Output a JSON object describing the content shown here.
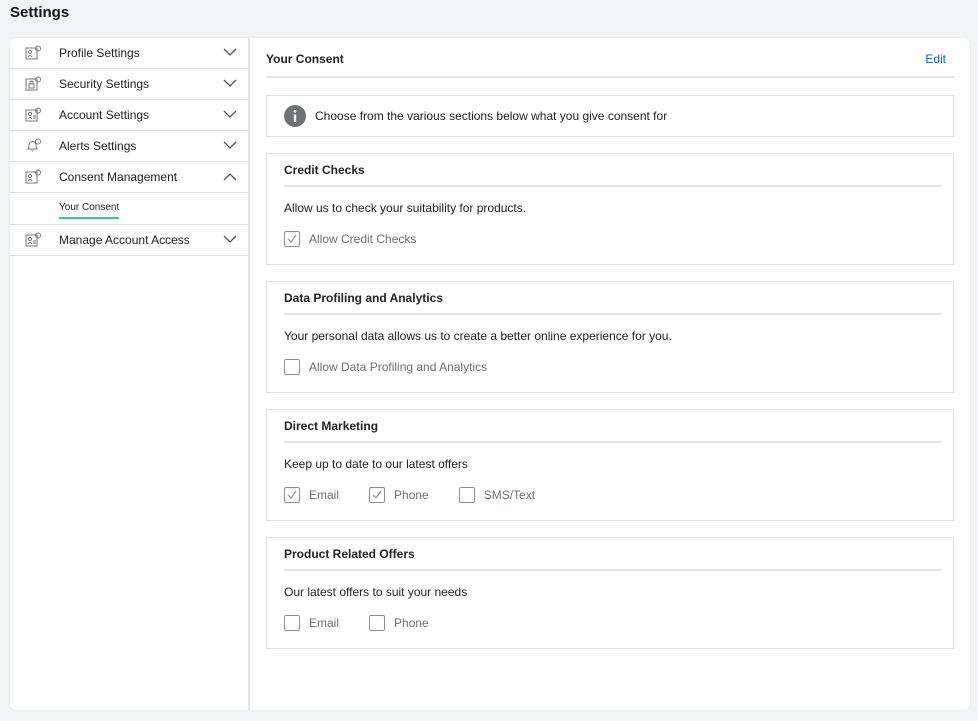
{
  "page": {
    "title": "Settings"
  },
  "sidebar": {
    "items": [
      {
        "label": "Profile Settings",
        "expanded": false
      },
      {
        "label": "Security Settings",
        "expanded": false
      },
      {
        "label": "Account Settings",
        "expanded": false
      },
      {
        "label": "Alerts Settings",
        "expanded": false
      },
      {
        "label": "Consent Management",
        "expanded": true,
        "subitems": [
          {
            "label": "Your Consent",
            "active": true
          }
        ]
      },
      {
        "label": "Manage Account Access",
        "expanded": false
      }
    ]
  },
  "main": {
    "title": "Your Consent",
    "edit_label": "Edit",
    "info_text": "Choose from the various sections below what you give consent for",
    "sections": [
      {
        "title": "Credit Checks",
        "description": "Allow us to check your suitability for products.",
        "options": [
          {
            "label": "Allow Credit Checks",
            "checked": true
          }
        ]
      },
      {
        "title": "Data Profiling and Analytics",
        "description": "Your personal data allows us to create a better online experience for you.",
        "options": [
          {
            "label": "Allow Data Profiling and Analytics",
            "checked": false
          }
        ]
      },
      {
        "title": "Direct Marketing",
        "description": "Keep up to date to our latest offers",
        "options": [
          {
            "label": "Email",
            "checked": true
          },
          {
            "label": "Phone",
            "checked": true
          },
          {
            "label": "SMS/Text",
            "checked": false
          }
        ]
      },
      {
        "title": "Product Related Offers",
        "description": "Our latest offers to suit your needs",
        "options": [
          {
            "label": "Email",
            "checked": false
          },
          {
            "label": "Phone",
            "checked": false
          }
        ]
      }
    ]
  },
  "colors": {
    "accent_underline": "#3cc79a",
    "link": "#1a5ea8",
    "border": "#dcdfe3"
  }
}
